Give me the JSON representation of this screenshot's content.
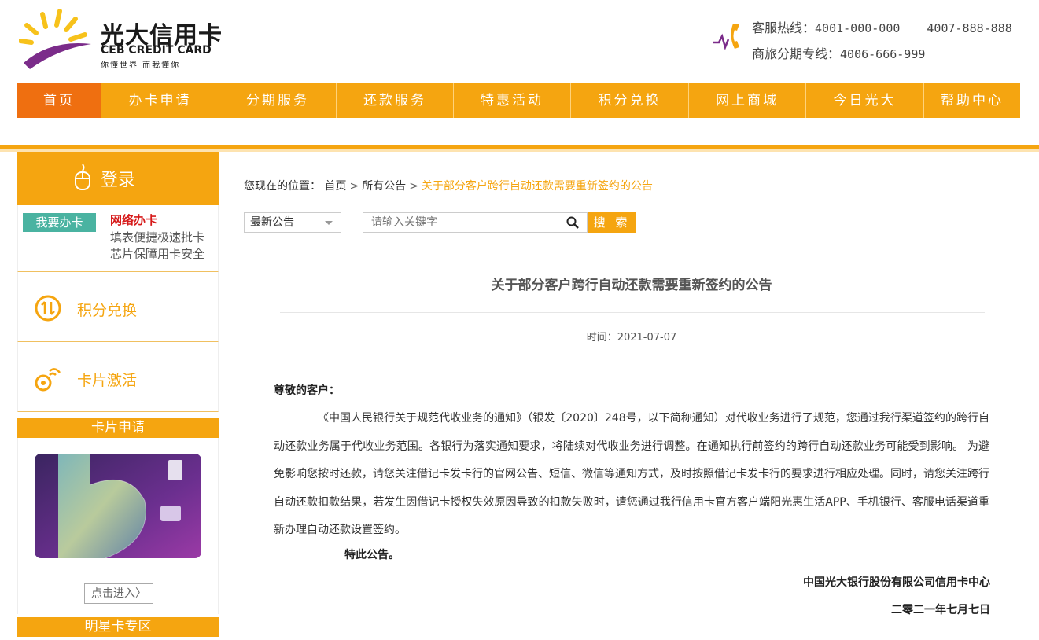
{
  "header": {
    "logo_cn": "光大信用卡",
    "logo_en": "CEB CREDIT CARD",
    "logo_slogan": "你懂世界  而我懂你",
    "hotline_label": "客服热线：",
    "hotline_1": "4001-000-000",
    "hotline_2": "4007-888-888",
    "installment_label": "商旅分期专线：",
    "installment_number": "4006-666-999"
  },
  "nav": {
    "items": [
      "首页",
      "办卡申请",
      "分期服务",
      "还款服务",
      "特惠活动",
      "积分兑换",
      "网上商城",
      "今日光大",
      "帮助中心"
    ],
    "active": "首页"
  },
  "sidebar": {
    "login": "登录",
    "apply_button": "我要办卡",
    "apply_title": "网络办卡",
    "apply_line1": "填表便捷极速批卡",
    "apply_line2": "芯片保障用卡安全",
    "points": "积分兑换",
    "activate": "卡片激活",
    "card_apply": "卡片申请",
    "enter": "点击进入〉",
    "star_card": "明星卡专区"
  },
  "breadcrumb": {
    "prefix": "您现在的位置：",
    "home": "首页",
    "list": "所有公告",
    "current": "关于部分客户跨行自动还款需要重新签约的公告"
  },
  "filter": {
    "category": "最新公告",
    "search_placeholder": "请输入关键字",
    "search_button": "搜 索"
  },
  "article": {
    "title": "关于部分客户跨行自动还款需要重新签约的公告",
    "time": "时间：2021-07-07",
    "greeting": "尊敬的客户：",
    "body": "《中国人民银行关于规范代收业务的通知》（银发〔2020〕248号，以下简称通知）对代收业务进行了规范，您通过我行渠道签约的跨行自动还款业务属于代收业务范围。各银行为落实通知要求，将陆续对代收业务进行调整。在通知执行前签约的跨行自动还款业务可能受到影响。 为避免影响您按时还款，请您关注借记卡发卡行的官网公告、短信、微信等通知方式，及时按照借记卡发卡行的要求进行相应处理。同时，请您关注跨行自动还款扣款结果，若发生因借记卡授权失效原因导致的扣款失败时，请您通过我行信用卡官方客户端阳光惠生活APP、手机银行、客服电话渠道重新办理自动还款设置签约。",
    "closing": "特此公告。",
    "signature": "中国光大银行股份有限公司信用卡中心",
    "date": "二零二一年七月七日"
  },
  "colors": {
    "primary": "#f5a510",
    "active_nav": "#ef6f10",
    "apply_button": "#4ab3a1",
    "highlight_red": "#d61a1a"
  }
}
